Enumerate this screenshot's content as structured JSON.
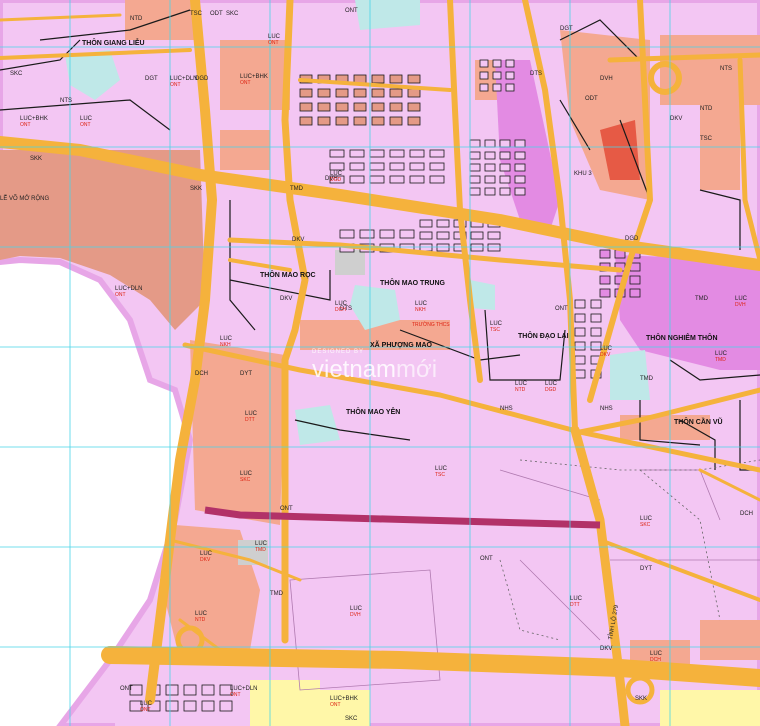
{
  "map": {
    "colors": {
      "residential": "#f3c6f3",
      "residential_urban": "#e38be3",
      "agricultural": "#f4a891",
      "industrial": "#e49a87",
      "road": "#f5b23c",
      "border": "#e7a6e7",
      "grid": "#49d5e8",
      "planned_road": "#b23168",
      "water": "#bfe8e8",
      "green": "#9ed6b2",
      "yellow": "#fff7a8",
      "gray": "#cfcfcf"
    },
    "watermark": {
      "brand_main": "vietnam",
      "brand_accent": "mới",
      "tagline": "DESIGNED BY"
    },
    "place_labels": [
      {
        "id": "thon-giang-lieu",
        "text": "THÔN GIANG LIỄU",
        "style": "bold"
      },
      {
        "id": "le-vo-mo-rong",
        "text": "LỄ VÕ MỞ RỘNG",
        "style": "normal"
      },
      {
        "id": "thon-mao-ruc",
        "text": "THÔN MAO RỌC",
        "style": "bold"
      },
      {
        "id": "thon-mao-trung",
        "text": "THÔN MAO TRUNG",
        "style": "bold"
      },
      {
        "id": "xa-phuong-mao",
        "text": "XÃ PHƯỢNG MAO",
        "style": "bold"
      },
      {
        "id": "thon-dao-lai",
        "text": "THÔN ĐẠO LẠI",
        "style": "bold"
      },
      {
        "id": "thon-nghiem-thon",
        "text": "THÔN NGHIÊM THÔN",
        "style": "bold"
      },
      {
        "id": "thon-mao-yen",
        "text": "THÔN MAO YÊN",
        "style": "bold"
      },
      {
        "id": "thon-can-vu",
        "text": "THÔN CẦN VŨ",
        "style": "bold"
      },
      {
        "id": "khu-3",
        "text": "KHU 3",
        "style": "normal"
      }
    ],
    "land_codes": [
      {
        "text": "ONT",
        "sub": ""
      },
      {
        "text": "LUC",
        "sub": "ONT"
      },
      {
        "text": "LUC+DLN",
        "sub": "ONT"
      },
      {
        "text": "LUC+BHK",
        "sub": "ONT"
      },
      {
        "text": "SKC",
        "sub": ""
      },
      {
        "text": "SKK",
        "sub": ""
      },
      {
        "text": "TMD",
        "sub": ""
      },
      {
        "text": "DGD",
        "sub": ""
      },
      {
        "text": "NTD",
        "sub": ""
      },
      {
        "text": "NTS",
        "sub": ""
      },
      {
        "text": "DKV",
        "sub": ""
      },
      {
        "text": "DVH",
        "sub": ""
      },
      {
        "text": "DTS",
        "sub": ""
      },
      {
        "text": "DGT",
        "sub": ""
      },
      {
        "text": "TSC",
        "sub": ""
      },
      {
        "text": "ODT",
        "sub": ""
      },
      {
        "text": "DCH",
        "sub": ""
      },
      {
        "text": "DYT",
        "sub": ""
      },
      {
        "text": "LUC",
        "sub": "DTT"
      },
      {
        "text": "LUC",
        "sub": "SKC"
      },
      {
        "text": "TMD",
        "sub": ""
      },
      {
        "text": "LUC",
        "sub": "TMD"
      },
      {
        "text": "LUC",
        "sub": "DKV"
      },
      {
        "text": "LUC",
        "sub": "NTD"
      },
      {
        "text": "LUC",
        "sub": "DGD"
      },
      {
        "text": "NHS",
        "sub": ""
      },
      {
        "text": "DKV",
        "sub": ""
      },
      {
        "text": "LUC",
        "sub": "DCH"
      },
      {
        "text": "LUC",
        "sub": "NKH"
      },
      {
        "text": "LUC",
        "sub": "TSC"
      },
      {
        "text": "ONT",
        "sub": ""
      },
      {
        "text": "LUC",
        "sub": "DVH"
      }
    ],
    "road_label": "TỈNH LỘ 279",
    "school_label": "TRƯỜNG THCS"
  }
}
